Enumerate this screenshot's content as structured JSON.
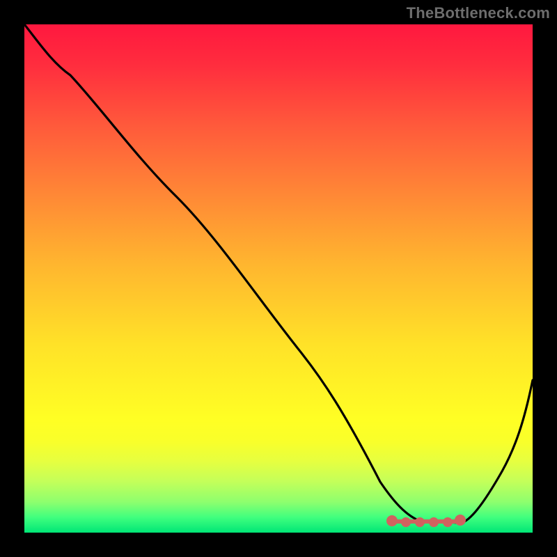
{
  "watermark": "TheBottleneck.com",
  "colors": {
    "background": "#000000",
    "curve": "#000000",
    "flat_marker": "#d0625f",
    "gradient_top": "#ff183f",
    "gradient_bottom": "#00e676"
  },
  "chart_data": {
    "type": "line",
    "title": "",
    "xlabel": "",
    "ylabel": "",
    "xlim": [
      0,
      100
    ],
    "ylim": [
      0,
      100
    ],
    "grid": false,
    "legend": false,
    "annotations": [
      "TheBottleneck.com"
    ],
    "series": [
      {
        "name": "bottleneck-curve",
        "x": [
          0,
          4,
          9,
          15,
          22,
          30,
          38,
          46,
          54,
          60,
          65,
          70,
          75,
          80,
          83,
          86,
          90,
          94,
          98,
          100
        ],
        "y": [
          100,
          95,
          90,
          84,
          76,
          66,
          56,
          46,
          36,
          26,
          17,
          10,
          5,
          2,
          2,
          2,
          5,
          12,
          22,
          30
        ]
      },
      {
        "name": "flat-minimum-marker",
        "x": [
          72,
          75,
          78,
          81,
          84,
          86
        ],
        "y": [
          2,
          2,
          2,
          2,
          2,
          2
        ]
      }
    ],
    "note": "Values are estimated from pixel positions relative to the 730×730 plot area; the curve descends from top-left, reaches a broad minimum around x≈75–85, then rises toward the right edge."
  }
}
